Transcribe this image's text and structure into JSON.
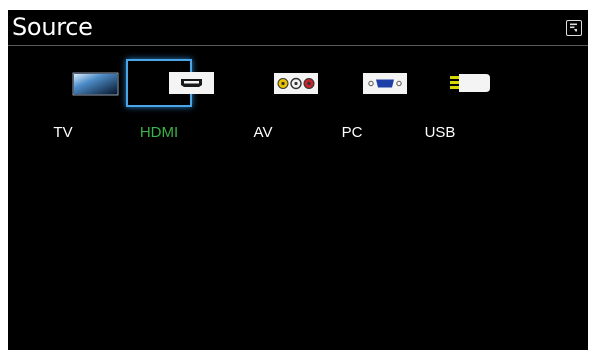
{
  "header": {
    "title": "Source"
  },
  "sources": [
    {
      "label": "TV",
      "icon": "tv-icon",
      "selected": false
    },
    {
      "label": "HDMI",
      "icon": "hdmi-icon",
      "selected": true
    },
    {
      "label": "AV",
      "icon": "av-icon",
      "selected": false
    },
    {
      "label": "PC",
      "icon": "pc-icon",
      "selected": false
    },
    {
      "label": "USB",
      "icon": "usb-icon",
      "selected": false
    }
  ],
  "colors": {
    "background": "#000000",
    "focus_border": "#4aa6e8",
    "active_label": "#39b34a",
    "label": "#ffffff"
  }
}
